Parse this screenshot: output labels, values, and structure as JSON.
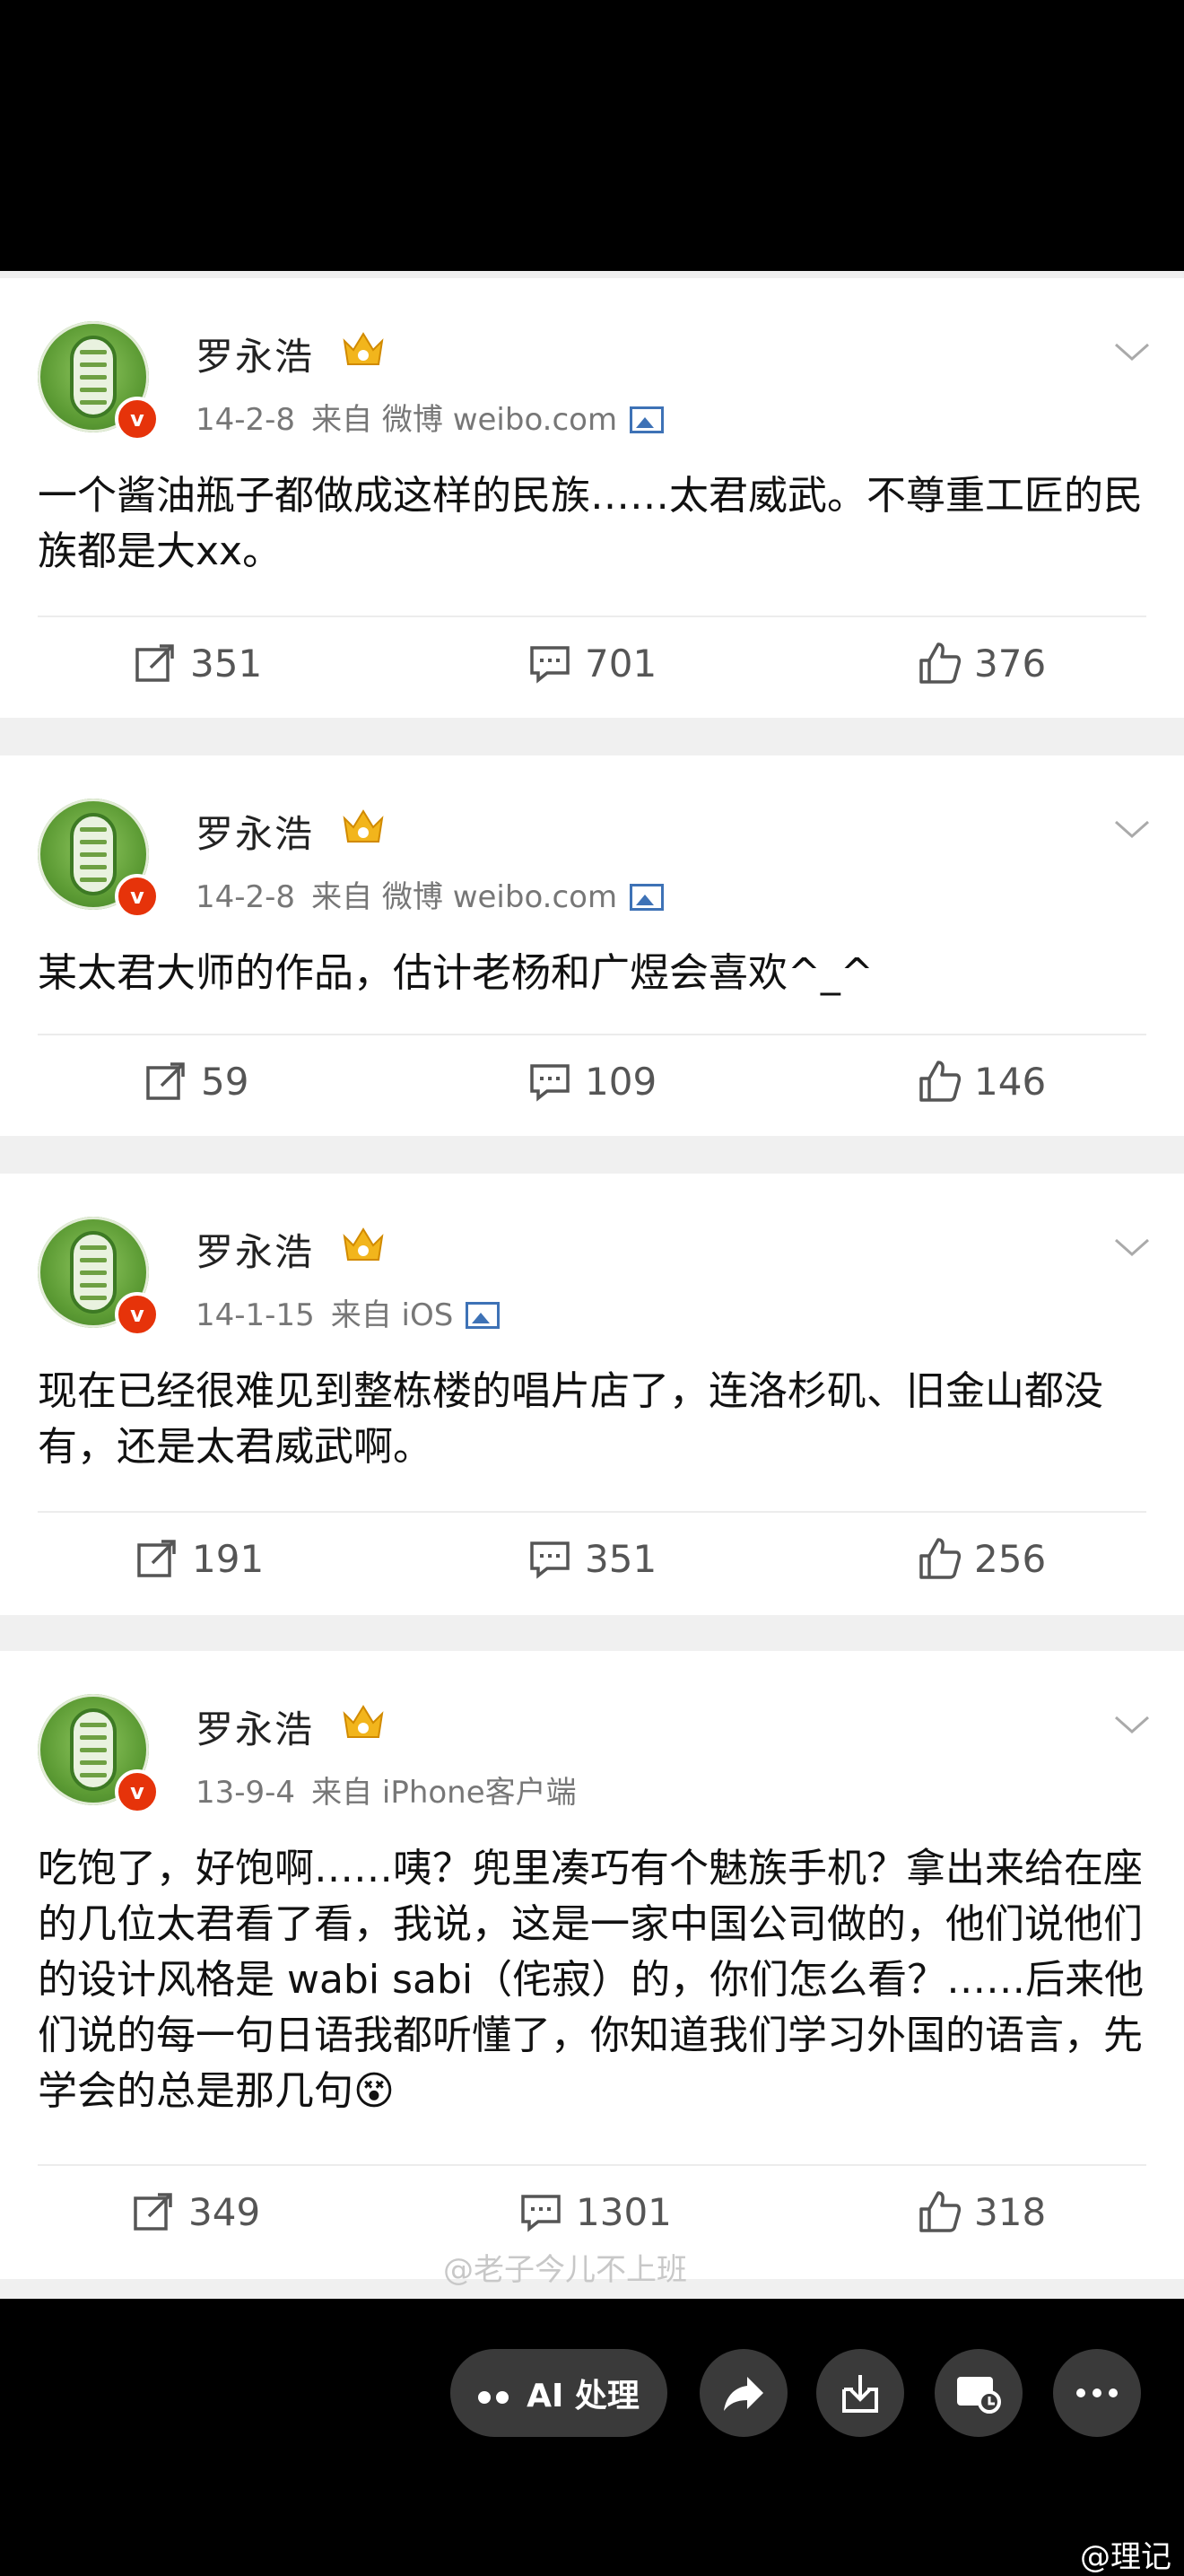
{
  "posts": [
    {
      "name": "罗永浩",
      "verified_badge": "v",
      "date": "14-2-8",
      "source": "来自 微博 weibo.com",
      "has_pic_icon": true,
      "text": "一个酱油瓶子都做成这样的民族……太君威武。不尊重工匠的民族都是大xx。",
      "repost": "351",
      "comment": "701",
      "like": "376"
    },
    {
      "name": "罗永浩",
      "verified_badge": "v",
      "date": "14-2-8",
      "source": "来自 微博 weibo.com",
      "has_pic_icon": true,
      "text": "某太君大师的作品，估计老杨和广煜会喜欢^_^",
      "repost": "59",
      "comment": "109",
      "like": "146"
    },
    {
      "name": "罗永浩",
      "verified_badge": "v",
      "date": "14-1-15",
      "source": "来自 iOS",
      "has_pic_icon": true,
      "text": "现在已经很难见到整栋楼的唱片店了，连洛杉矶、旧金山都没有，还是太君威武啊。",
      "repost": "191",
      "comment": "351",
      "like": "256"
    },
    {
      "name": "罗永浩",
      "verified_badge": "v",
      "date": "13-9-4",
      "source": "来自 iPhone客户端",
      "has_pic_icon": false,
      "text": "吃饱了，好饱啊……咦？兜里凑巧有个魅族手机？拿出来给在座的几位太君看了看，我说，这是一家中国公司做的，他们说他们的设计风格是 wabi sabi（侘寂）的，你们怎么看？……后来他们说的每一句日语我都听懂了，你知道我们学习外国的语言，先学会的总是那几句😵",
      "repost": "349",
      "comment": "1301",
      "like": "318"
    }
  ],
  "watermark": "@老子今儿不上班",
  "toolbar": {
    "ai_label": "AI 处理"
  },
  "corner_mark": "@理记",
  "colors": {
    "verified_red": "#e6330a",
    "link_blue": "#3e72b6",
    "toolbar_bg": "#3a3a3a"
  }
}
